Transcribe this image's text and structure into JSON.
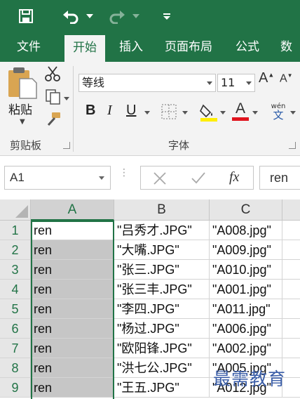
{
  "quick_access": {
    "icons": [
      "save-icon",
      "undo-icon",
      "redo-icon",
      "customize-icon"
    ]
  },
  "ribbon_tabs": [
    "文件",
    "开始",
    "插入",
    "页面布局",
    "公式",
    "数"
  ],
  "active_tab": "开始",
  "clipboard": {
    "paste_label": "粘贴",
    "group_label": "剪贴板"
  },
  "font_group": {
    "font_name": "等线",
    "font_size": "11",
    "bold": "B",
    "italic": "I",
    "underline": "U",
    "font_color_letter": "A",
    "grow": "A",
    "shrink": "A",
    "phonetic": "wén",
    "phonetic_char": "文",
    "group_label": "字体",
    "highlight_color": "#ffee00",
    "font_color": "#e0141e"
  },
  "formula_bar": {
    "name_box": "A1",
    "fx": "fx",
    "value": "ren"
  },
  "grid": {
    "columns": [
      "A",
      "B",
      "C"
    ],
    "rows": [
      {
        "num": "1",
        "a": "ren",
        "b": "\"吕秀才.JPG\"",
        "c": "\"A008.jpg\""
      },
      {
        "num": "2",
        "a": "ren",
        "b": "\"大嘴.JPG\"",
        "c": "\"A009.jpg\""
      },
      {
        "num": "3",
        "a": "ren",
        "b": "\"张三.JPG\"",
        "c": "\"A010.jpg\""
      },
      {
        "num": "4",
        "a": "ren",
        "b": "\"张三丰.JPG\"",
        "c": "\"A001.jpg\""
      },
      {
        "num": "5",
        "a": "ren",
        "b": "\"李四.JPG\"",
        "c": "\"A011.jpg\""
      },
      {
        "num": "6",
        "a": "ren",
        "b": "\"杨过.JPG\"",
        "c": "\"A006.jpg\""
      },
      {
        "num": "7",
        "a": "ren",
        "b": "\"欧阳锋.JPG\"",
        "c": "\"A002.jpg\""
      },
      {
        "num": "8",
        "a": "ren",
        "b": "\"洪七公.JPG\"",
        "c": "\"A005.jpg\""
      },
      {
        "num": "9",
        "a": "ren",
        "b": "\"王五.JPG\"",
        "c": "\"A012.jpg\""
      }
    ]
  },
  "watermark": "最需教育",
  "colors": {
    "excel_green": "#217346",
    "selection_gray": "#c6c6c6"
  }
}
